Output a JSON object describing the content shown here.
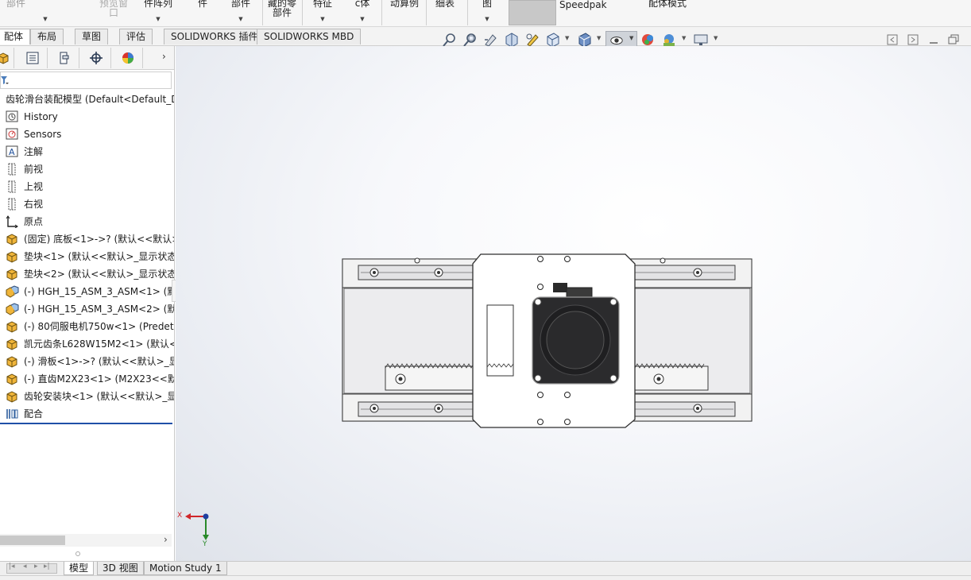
{
  "ribbon": {
    "items": [
      "部件",
      "预览窗口",
      "件阵列",
      "件",
      "部件",
      "藏的零部件",
      "特征",
      "с体",
      "动算例",
      "细表",
      "图",
      "Speedpak",
      "配体模式"
    ]
  },
  "command_tabs": [
    "配体",
    "布局",
    "草图",
    "评估",
    "SOLIDWORKS 插件",
    "SOLIDWORKS MBD"
  ],
  "feature_tree": {
    "root": "齿轮滑台装配模型  (Default<Default_D",
    "items": [
      "History",
      "Sensors",
      "注解",
      "前视",
      "上视",
      "右视",
      "原点",
      "(固定) 底板<1>->? (默认<<默认>",
      "垫块<1> (默认<<默认>_显示状态",
      "垫块<2> (默认<<默认>_显示状态",
      "(-) HGH_15_ASM_3_ASM<1> (默认",
      "(-) HGH_15_ASM_3_ASM<2> (默认",
      "(-) 80伺服电机750w<1> (Predete",
      "凯元齿条L628W15M2<1> (默认<",
      "(-) 滑板<1>->? (默认<<默认>_显",
      "(-) 直齿M2X23<1> (M2X23<<默",
      "齿轮安装块<1> (默认<<默认>_显",
      "配合"
    ]
  },
  "bottom_tabs": [
    "模型",
    "3D 视图",
    "Motion Study 1"
  ],
  "triad": {
    "x_label": "X",
    "y_label": "Y"
  },
  "colors": {
    "accent": "#1f4fa8",
    "triad_x": "#d0262a",
    "triad_y": "#2a8a2a"
  }
}
